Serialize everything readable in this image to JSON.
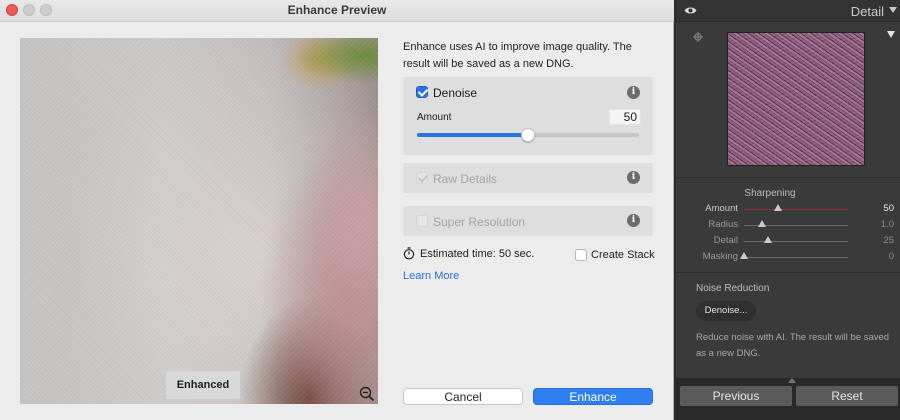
{
  "dialog": {
    "title": "Enhance Preview",
    "preview": {
      "overlay_label": "Enhanced",
      "zoom_icon": "zoom-out-icon"
    },
    "intro_text": "Enhance uses AI to improve image quality. The result will be saved as a new DNG.",
    "denoise": {
      "label": "Denoise",
      "checked": true,
      "amount_label": "Amount",
      "amount_value": "50",
      "amount_fraction": 0.5
    },
    "raw_details": {
      "label": "Raw Details",
      "checked": true,
      "enabled": false
    },
    "super_resolution": {
      "label": "Super Resolution",
      "checked": false,
      "enabled": false
    },
    "estimated_time": "Estimated time: 50 sec.",
    "create_stack": {
      "label": "Create Stack",
      "checked": false
    },
    "learn_more": "Learn More",
    "buttons": {
      "cancel": "Cancel",
      "enhance": "Enhance"
    },
    "colors": {
      "accent": "#2f7ef2",
      "link": "#2a6fd9",
      "close": "#ee5b56"
    }
  },
  "lightroom_panel": {
    "title": "Detail",
    "sharpening": {
      "title": "Sharpening",
      "sliders": [
        {
          "label": "Amount",
          "value": "50",
          "fraction": 0.33,
          "active": true
        },
        {
          "label": "Radius",
          "value": "1.0",
          "fraction": 0.17,
          "active": false
        },
        {
          "label": "Detail",
          "value": "25",
          "fraction": 0.23,
          "active": false
        },
        {
          "label": "Masking",
          "value": "0",
          "fraction": 0.0,
          "active": false
        }
      ]
    },
    "noise_reduction": {
      "title": "Noise Reduction",
      "button": "Denoise...",
      "description": "Reduce noise with AI. The result will be saved as a new DNG."
    },
    "footer": {
      "previous": "Previous",
      "reset": "Reset"
    }
  }
}
